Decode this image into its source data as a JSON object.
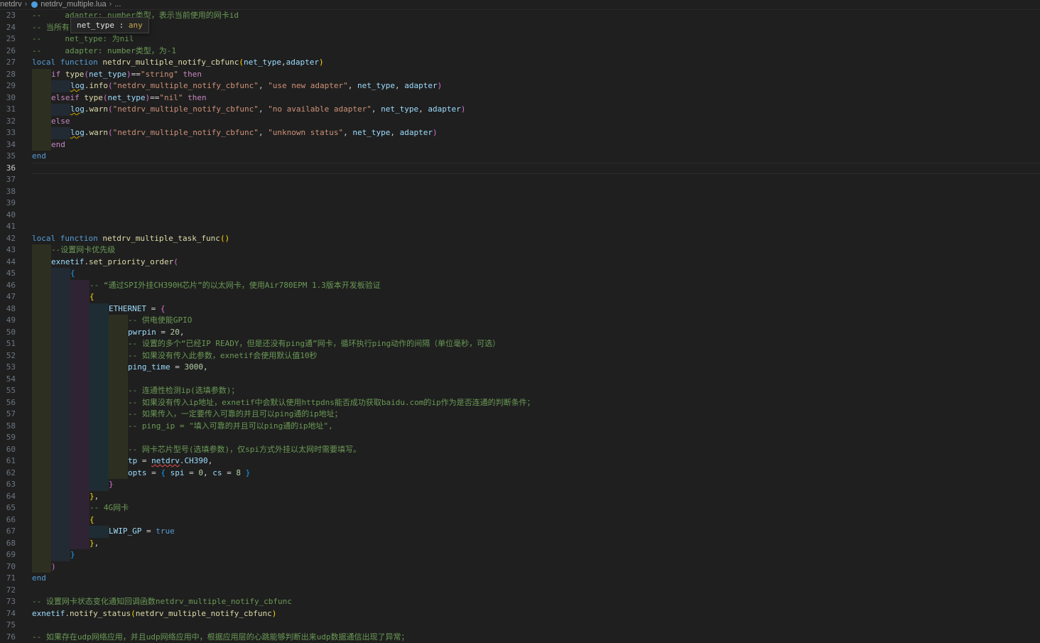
{
  "breadcrumb": {
    "folder": "netdrv",
    "file": "netdrv_multiple.lua",
    "more": "..."
  },
  "hover": {
    "name": "net_type",
    "sep": " : ",
    "type": "any"
  },
  "editor": {
    "first_line": 23,
    "active_line": 36,
    "lines": [
      {
        "n": "23",
        "indent": 0,
        "tokens": [
          [
            "cmt",
            "--     adapter: number类型，表示当前使用的网卡id"
          ]
        ]
      },
      {
        "n": "24",
        "indent": 0,
        "tokens": [
          [
            "cmt",
            "-- 当所有"
          ]
        ]
      },
      {
        "n": "25",
        "indent": 0,
        "tokens": [
          [
            "cmt",
            "--     net_type: 为nil"
          ]
        ]
      },
      {
        "n": "26",
        "indent": 0,
        "tokens": [
          [
            "cmt",
            "--     adapter: number类型，为-1"
          ]
        ]
      },
      {
        "n": "27",
        "indent": 0,
        "tokens": [
          [
            "kw",
            "local"
          ],
          [
            "op",
            " "
          ],
          [
            "kw",
            "function"
          ],
          [
            "op",
            " "
          ],
          [
            "fn",
            "netdrv_multiple_notify_cbfunc"
          ],
          [
            "b1",
            "("
          ],
          [
            "var",
            "net_type"
          ],
          [
            "op",
            ","
          ],
          [
            "var",
            "adapter"
          ],
          [
            "b1",
            ")"
          ]
        ]
      },
      {
        "n": "28",
        "indent": 1,
        "tokens": [
          [
            "kw2",
            "if"
          ],
          [
            "op",
            " "
          ],
          [
            "fn",
            "type"
          ],
          [
            "b2",
            "("
          ],
          [
            "var",
            "net_type"
          ],
          [
            "b2",
            ")"
          ],
          [
            "op",
            "=="
          ],
          [
            "str",
            "\"string\""
          ],
          [
            "op",
            " "
          ],
          [
            "kw2",
            "then"
          ]
        ]
      },
      {
        "n": "29",
        "indent": 2,
        "tokens": [
          [
            "var squig",
            "log"
          ],
          [
            "op",
            "."
          ],
          [
            "fn",
            "info"
          ],
          [
            "b2",
            "("
          ],
          [
            "str",
            "\"netdrv_multiple_notify_cbfunc\""
          ],
          [
            "op",
            ", "
          ],
          [
            "str",
            "\"use new adapter\""
          ],
          [
            "op",
            ", "
          ],
          [
            "var",
            "net_type"
          ],
          [
            "op",
            ", "
          ],
          [
            "var",
            "adapter"
          ],
          [
            "b2",
            ")"
          ]
        ]
      },
      {
        "n": "30",
        "indent": 1,
        "tokens": [
          [
            "kw2",
            "elseif"
          ],
          [
            "op",
            " "
          ],
          [
            "fn",
            "type"
          ],
          [
            "b2",
            "("
          ],
          [
            "var",
            "net_type"
          ],
          [
            "b2",
            ")"
          ],
          [
            "op",
            "=="
          ],
          [
            "str",
            "\"nil\""
          ],
          [
            "op",
            " "
          ],
          [
            "kw2",
            "then"
          ]
        ]
      },
      {
        "n": "31",
        "indent": 2,
        "tokens": [
          [
            "var squig",
            "log"
          ],
          [
            "op",
            "."
          ],
          [
            "fn",
            "warn"
          ],
          [
            "b2",
            "("
          ],
          [
            "str",
            "\"netdrv_multiple_notify_cbfunc\""
          ],
          [
            "op",
            ", "
          ],
          [
            "str",
            "\"no available adapter\""
          ],
          [
            "op",
            ", "
          ],
          [
            "var",
            "net_type"
          ],
          [
            "op",
            ", "
          ],
          [
            "var",
            "adapter"
          ],
          [
            "b2",
            ")"
          ]
        ]
      },
      {
        "n": "32",
        "indent": 1,
        "tokens": [
          [
            "kw2",
            "else"
          ]
        ]
      },
      {
        "n": "33",
        "indent": 2,
        "tokens": [
          [
            "var squig",
            "log"
          ],
          [
            "op",
            "."
          ],
          [
            "fn",
            "warn"
          ],
          [
            "b2",
            "("
          ],
          [
            "str",
            "\"netdrv_multiple_notify_cbfunc\""
          ],
          [
            "op",
            ", "
          ],
          [
            "str",
            "\"unknown status\""
          ],
          [
            "op",
            ", "
          ],
          [
            "var",
            "net_type"
          ],
          [
            "op",
            ", "
          ],
          [
            "var",
            "adapter"
          ],
          [
            "b2",
            ")"
          ]
        ]
      },
      {
        "n": "34",
        "indent": 1,
        "tokens": [
          [
            "kw2",
            "end"
          ]
        ]
      },
      {
        "n": "35",
        "indent": 0,
        "tokens": [
          [
            "kw",
            "end"
          ]
        ]
      },
      {
        "n": "36",
        "indent": 0,
        "tokens": []
      },
      {
        "n": "37",
        "indent": 0,
        "tokens": []
      },
      {
        "n": "38",
        "indent": 0,
        "tokens": []
      },
      {
        "n": "39",
        "indent": 0,
        "tokens": []
      },
      {
        "n": "40",
        "indent": 0,
        "tokens": []
      },
      {
        "n": "41",
        "indent": 0,
        "tokens": []
      },
      {
        "n": "42",
        "indent": 0,
        "tokens": [
          [
            "kw",
            "local"
          ],
          [
            "op",
            " "
          ],
          [
            "kw",
            "function"
          ],
          [
            "op",
            " "
          ],
          [
            "fn",
            "netdrv_multiple_task_func"
          ],
          [
            "b1",
            "()"
          ]
        ]
      },
      {
        "n": "43",
        "indent": 1,
        "tokens": [
          [
            "cmt",
            "--设置网卡优先级"
          ]
        ]
      },
      {
        "n": "44",
        "indent": 1,
        "tokens": [
          [
            "var",
            "exnetif"
          ],
          [
            "op",
            "."
          ],
          [
            "fn",
            "set_priority_order"
          ],
          [
            "b2",
            "("
          ]
        ]
      },
      {
        "n": "45",
        "indent": 2,
        "tokens": [
          [
            "b3",
            "{"
          ]
        ]
      },
      {
        "n": "46",
        "indent": 3,
        "tokens": [
          [
            "cmt",
            "-- “通过SPI外挂CH390H芯片”的以太网卡，使用Air780EPM 1.3版本开发板验证"
          ]
        ]
      },
      {
        "n": "47",
        "indent": 3,
        "tokens": [
          [
            "b1",
            "{"
          ]
        ]
      },
      {
        "n": "48",
        "indent": 4,
        "tokens": [
          [
            "var",
            "ETHERNET"
          ],
          [
            "op",
            " = "
          ],
          [
            "b2",
            "{"
          ]
        ]
      },
      {
        "n": "49",
        "indent": 5,
        "tokens": [
          [
            "cmt",
            "-- 供电使能GPIO"
          ]
        ]
      },
      {
        "n": "50",
        "indent": 5,
        "tokens": [
          [
            "var",
            "pwrpin"
          ],
          [
            "op",
            " = "
          ],
          [
            "num",
            "20"
          ],
          [
            "op",
            ","
          ]
        ]
      },
      {
        "n": "51",
        "indent": 5,
        "tokens": [
          [
            "cmt",
            "-- 设置的多个“已经IP READY，但是还没有ping通”网卡，循环执行ping动作的间隔（单位毫秒，可选）"
          ]
        ]
      },
      {
        "n": "52",
        "indent": 5,
        "tokens": [
          [
            "cmt",
            "-- 如果没有传入此参数，exnetif会使用默认值10秒"
          ]
        ]
      },
      {
        "n": "53",
        "indent": 5,
        "tokens": [
          [
            "var",
            "ping_time"
          ],
          [
            "op",
            " = "
          ],
          [
            "num",
            "3000"
          ],
          [
            "op",
            ","
          ]
        ]
      },
      {
        "n": "54",
        "indent": 0,
        "tokens": []
      },
      {
        "n": "55",
        "indent": 5,
        "tokens": [
          [
            "cmt",
            "-- 连通性检测ip(选填参数)；"
          ]
        ]
      },
      {
        "n": "56",
        "indent": 5,
        "tokens": [
          [
            "cmt",
            "-- 如果没有传入ip地址，exnetif中会默认使用httpdns能否成功获取baidu.com的ip作为是否连通的判断条件；"
          ]
        ]
      },
      {
        "n": "57",
        "indent": 5,
        "tokens": [
          [
            "cmt",
            "-- 如果传入，一定要传入可靠的并且可以ping通的ip地址；"
          ]
        ]
      },
      {
        "n": "58",
        "indent": 5,
        "tokens": [
          [
            "cmt",
            "-- ping_ip = \"填入可靠的并且可以ping通的ip地址\","
          ]
        ]
      },
      {
        "n": "59",
        "indent": 0,
        "tokens": []
      },
      {
        "n": "60",
        "indent": 5,
        "tokens": [
          [
            "cmt",
            "-- 网卡芯片型号(选填参数)，仅spi方式外挂以太网时需要填写。"
          ]
        ]
      },
      {
        "n": "61",
        "indent": 5,
        "tokens": [
          [
            "var",
            "tp"
          ],
          [
            "op",
            " = "
          ],
          [
            "var squig-red",
            "netdrv"
          ],
          [
            "op",
            "."
          ],
          [
            "var",
            "CH390"
          ],
          [
            "op",
            ","
          ]
        ]
      },
      {
        "n": "62",
        "indent": 5,
        "tokens": [
          [
            "var",
            "opts"
          ],
          [
            "op",
            " = "
          ],
          [
            "b3",
            "{"
          ],
          [
            "op",
            " "
          ],
          [
            "var",
            "spi"
          ],
          [
            "op",
            " = "
          ],
          [
            "num",
            "0"
          ],
          [
            "op",
            ", "
          ],
          [
            "var",
            "cs"
          ],
          [
            "op",
            " = "
          ],
          [
            "num",
            "8"
          ],
          [
            "op",
            " "
          ],
          [
            "b3",
            "}"
          ]
        ]
      },
      {
        "n": "63",
        "indent": 4,
        "tokens": [
          [
            "b2",
            "}"
          ]
        ]
      },
      {
        "n": "64",
        "indent": 3,
        "tokens": [
          [
            "b1",
            "}"
          ],
          [
            "op",
            ","
          ]
        ]
      },
      {
        "n": "65",
        "indent": 3,
        "tokens": [
          [
            "cmt",
            "-- 4G网卡"
          ]
        ]
      },
      {
        "n": "66",
        "indent": 3,
        "tokens": [
          [
            "b1",
            "{"
          ]
        ]
      },
      {
        "n": "67",
        "indent": 4,
        "tokens": [
          [
            "var",
            "LWIP_GP"
          ],
          [
            "op",
            " = "
          ],
          [
            "kw",
            "true"
          ]
        ]
      },
      {
        "n": "68",
        "indent": 3,
        "tokens": [
          [
            "b1",
            "}"
          ],
          [
            "op",
            ","
          ]
        ]
      },
      {
        "n": "69",
        "indent": 2,
        "tokens": [
          [
            "b3",
            "}"
          ]
        ]
      },
      {
        "n": "70",
        "indent": 1,
        "tokens": [
          [
            "b2",
            ")"
          ]
        ]
      },
      {
        "n": "71",
        "indent": 0,
        "tokens": [
          [
            "kw",
            "end"
          ]
        ]
      },
      {
        "n": "72",
        "indent": 0,
        "tokens": []
      },
      {
        "n": "73",
        "indent": 0,
        "tokens": [
          [
            "cmt",
            "-- 设置网卡状态变化通知回调函数netdrv_multiple_notify_cbfunc"
          ]
        ]
      },
      {
        "n": "74",
        "indent": 0,
        "tokens": [
          [
            "var",
            "exnetif"
          ],
          [
            "op",
            "."
          ],
          [
            "fn",
            "notify_status"
          ],
          [
            "b1",
            "("
          ],
          [
            "fn",
            "netdrv_multiple_notify_cbfunc"
          ],
          [
            "b1",
            ")"
          ]
        ]
      },
      {
        "n": "75",
        "indent": 0,
        "tokens": []
      },
      {
        "n": "76",
        "indent": 0,
        "tokens": [
          [
            "cmt",
            "-- 如果存在udp网络应用，并且udp网络应用中，根据应用层的心跳能够判断出来udp数据通信出现了异常；"
          ]
        ]
      }
    ]
  }
}
